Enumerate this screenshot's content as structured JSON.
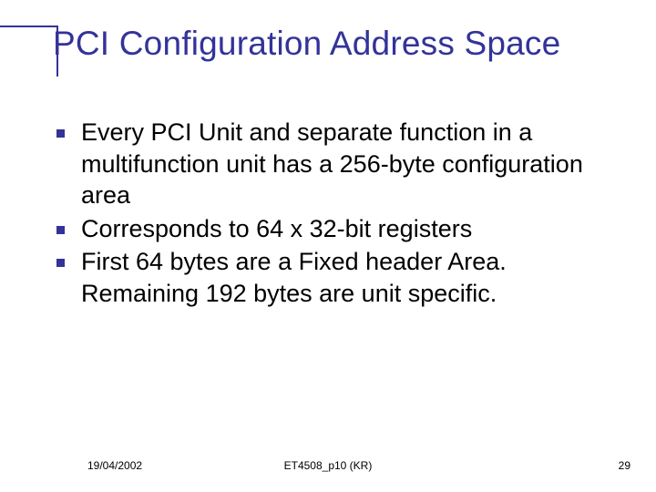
{
  "title": "PCI Configuration Address Space",
  "bullets": [
    "Every PCI Unit and separate function in a multifunction unit has a 256-byte configuration area",
    "Corresponds to 64 x 32-bit registers",
    "First 64 bytes are a Fixed header Area. Remaining 192 bytes are unit specific."
  ],
  "footer": {
    "date": "19/04/2002",
    "ref": "ET4508_p10 (KR)",
    "page": "29"
  }
}
